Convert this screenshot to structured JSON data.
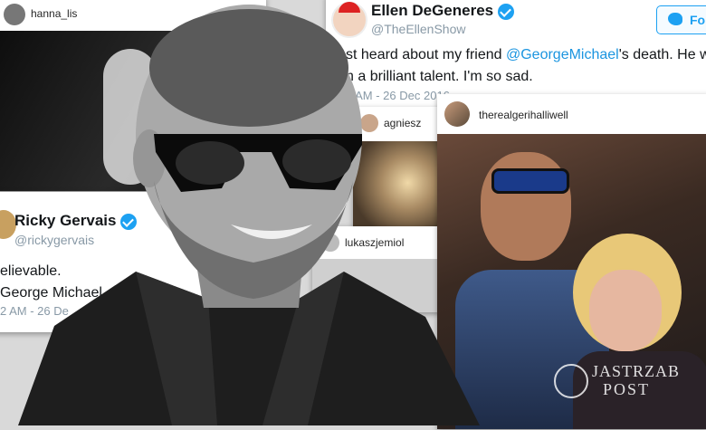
{
  "tweets": {
    "ellen": {
      "name": "Ellen DeGeneres",
      "handle": "@TheEllenShow",
      "follow_label": "Fol",
      "text_line1_pre": "st heard about my friend ",
      "text_mention": "@GeorgeMichael",
      "text_line1_post": "'s death. He w",
      "text_line2": "h a brilliant talent. I'm so sad.",
      "timestamp": "5 AM - 26 Dec 2016"
    },
    "ricky": {
      "name": "Ricky Gervais",
      "handle": "@rickygervais",
      "text_line1": "elievable.",
      "text_line2": "George Michael",
      "timestamp": "2 AM - 26 De"
    }
  },
  "instagram": {
    "hanna": {
      "username": "hanna_lis"
    },
    "agnieszka": {
      "username": "agniesz"
    },
    "lukasz": {
      "username": "lukaszjemiol"
    },
    "geri": {
      "username": "therealgerihalliwell"
    }
  },
  "watermark": {
    "line1": "JASTRZAB",
    "line2": "POST"
  },
  "colors": {
    "twitter_blue": "#1da1f2",
    "link_blue": "#1b95e0",
    "muted": "#8899a6"
  }
}
